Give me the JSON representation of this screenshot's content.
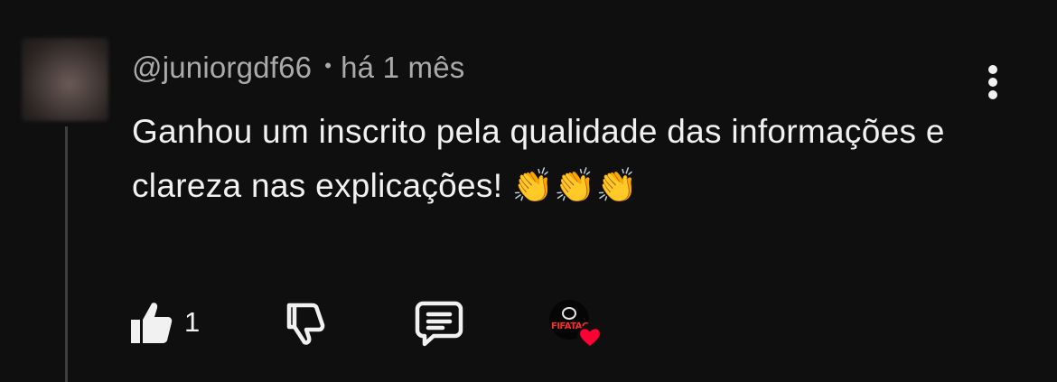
{
  "comment": {
    "author": "@juniorgdf66",
    "separator": "•",
    "time": "há 1 mês",
    "text": "Ganhou um inscrito pela qualidade das informações e clareza nas explicações! 👏👏👏"
  },
  "actions": {
    "like_count": "1",
    "icons": {
      "like": "thumbs-up-icon",
      "dislike": "thumbs-down-icon",
      "reply": "comment-reply-icon",
      "more": "kebab-menu-icon",
      "creator_heart": "creator-heart-icon"
    }
  },
  "colors": {
    "background": "#0f0f0f",
    "text_primary": "#f1f1f1",
    "text_secondary": "#aaaaaa",
    "heart": "#ff0033"
  }
}
